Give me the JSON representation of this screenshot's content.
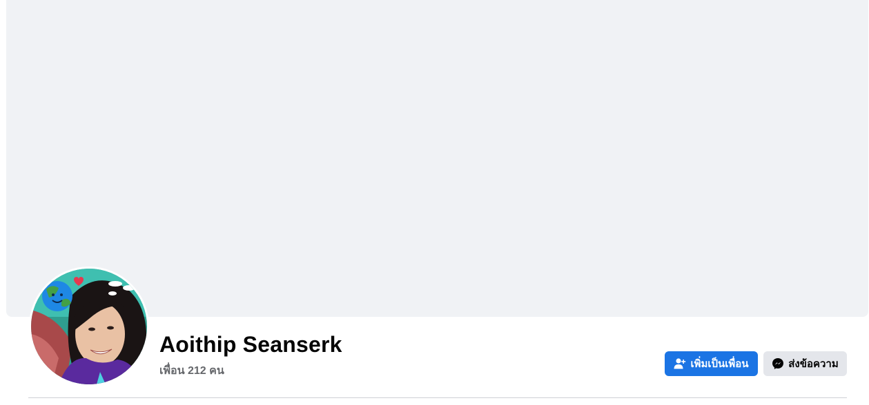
{
  "profile": {
    "name": "Aoithip Seanserk",
    "friends_text": "เพื่อน 212 คน"
  },
  "actions": {
    "add_friend_label": "เพิ่มเป็นเพื่อน",
    "message_label": "ส่งข้อความ"
  },
  "icons": {
    "add_friend": "add-friend-icon",
    "message": "messenger-icon"
  },
  "colors": {
    "cover_bg": "#f0f2f5",
    "primary_button": "#1b74e4",
    "secondary_button": "#e4e6eb",
    "name_text": "#050505",
    "secondary_text": "#65676b"
  }
}
